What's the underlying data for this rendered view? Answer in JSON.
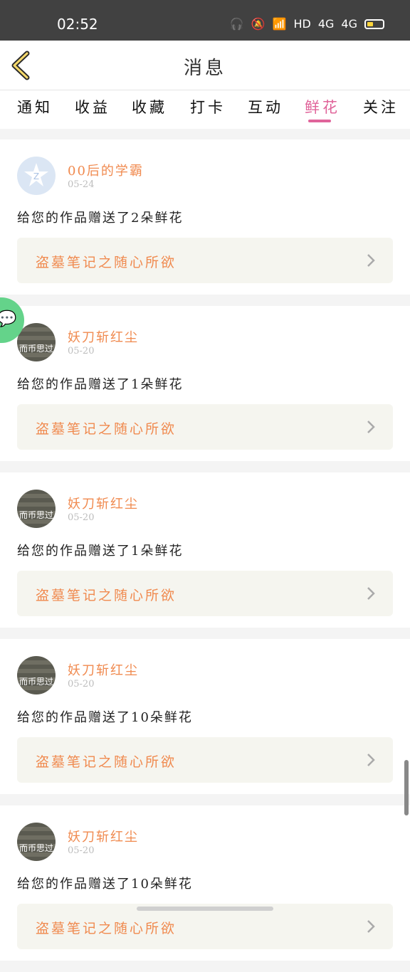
{
  "status_bar": {
    "time": "02:52",
    "hd_label": "HD",
    "net1": "4G",
    "net2": "4G"
  },
  "header": {
    "title": "消息"
  },
  "tabs": [
    {
      "label": "通知"
    },
    {
      "label": "收益"
    },
    {
      "label": "收藏"
    },
    {
      "label": "打卡"
    },
    {
      "label": "互动"
    },
    {
      "label": "鲜花",
      "active": true
    },
    {
      "label": "关注"
    }
  ],
  "messages": [
    {
      "name": "00后的学霸",
      "date": "05-24",
      "text": "给您的作品赠送了2朵鲜花",
      "work": "盗墓笔记之随心所欲",
      "avatar_text": ""
    },
    {
      "name": "妖刀斩红尘",
      "date": "05-20",
      "text": "给您的作品赠送了1朵鲜花",
      "work": "盗墓笔记之随心所欲",
      "avatar_text": "而币思过"
    },
    {
      "name": "妖刀斩红尘",
      "date": "05-20",
      "text": "给您的作品赠送了1朵鲜花",
      "work": "盗墓笔记之随心所欲",
      "avatar_text": "而币思过"
    },
    {
      "name": "妖刀斩红尘",
      "date": "05-20",
      "text": "给您的作品赠送了10朵鲜花",
      "work": "盗墓笔记之随心所欲",
      "avatar_text": "而币思过"
    },
    {
      "name": "妖刀斩红尘",
      "date": "05-20",
      "text": "给您的作品赠送了10朵鲜花",
      "work": "盗墓笔记之随心所欲",
      "avatar_text": "而币思过"
    }
  ],
  "colors": {
    "accent": "#e0649a",
    "name_text": "#f08a4f",
    "status_bar": "#414141"
  }
}
